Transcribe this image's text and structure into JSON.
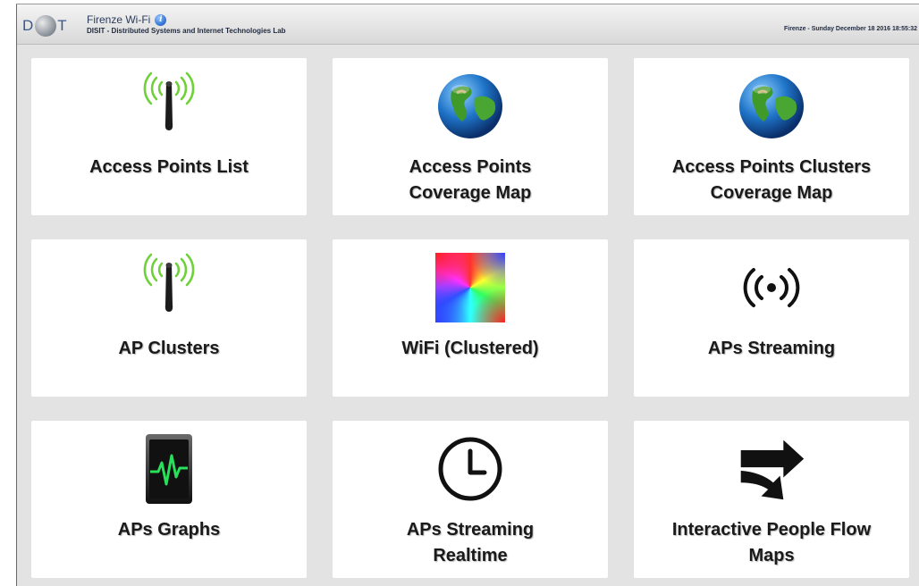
{
  "header": {
    "logo_text": "DISIT",
    "title": "Firenze Wi-Fi",
    "subtitle": "DISIT - Distributed Systems and Internet Technologies Lab",
    "datetime": "Firenze - Sunday December 18 2016 18:55:32"
  },
  "tiles": [
    {
      "icon": "wifi-antenna-icon",
      "lines": [
        "Access Points List"
      ]
    },
    {
      "icon": "globe-icon",
      "lines": [
        "Access Points",
        "Coverage Map"
      ]
    },
    {
      "icon": "globe-icon",
      "lines": [
        "Access Points Clusters",
        "Coverage Map"
      ]
    },
    {
      "icon": "wifi-antenna-icon",
      "lines": [
        "AP Clusters"
      ]
    },
    {
      "icon": "color-gradient-icon",
      "lines": [
        "WiFi (Clustered)"
      ]
    },
    {
      "icon": "broadcast-icon",
      "lines": [
        "APs Streaming"
      ]
    },
    {
      "icon": "pulse-monitor-icon",
      "lines": [
        "APs Graphs"
      ]
    },
    {
      "icon": "clock-icon",
      "lines": [
        "APs Streaming",
        "Realtime"
      ]
    },
    {
      "icon": "flow-arrows-icon",
      "lines": [
        "Interactive People Flow",
        "Maps"
      ]
    }
  ],
  "colors": {
    "page_background": "#e3e3e3",
    "tile_background": "#ffffff",
    "wifi_waves": "#6fd13a",
    "label_text": "#1a1a1a"
  }
}
